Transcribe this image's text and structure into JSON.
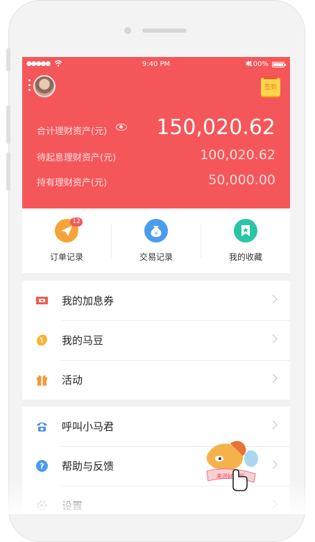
{
  "status_bar": {
    "signal": "●●●●●",
    "time": "9:40 PM",
    "bluetooth": "✱",
    "battery": "100%"
  },
  "header": {
    "signin_label": "签到",
    "total_label": "合计理财资产(元)",
    "total_value": "150,020.62",
    "pending_label": "待起息理财资产(元)",
    "pending_value": "100,020.62",
    "holding_label": "持有理财资产(元)",
    "holding_value": "50,000.00"
  },
  "quick_actions": [
    {
      "label": "订单记录",
      "badge": "12",
      "icon": "paper-plane-icon",
      "color": "#f6a43a"
    },
    {
      "label": "交易记录",
      "icon": "money-bag-icon",
      "color": "#4a9cf0"
    },
    {
      "label": "我的收藏",
      "icon": "bookmark-star-icon",
      "color": "#2bc4a7"
    }
  ],
  "menu_group_1": [
    {
      "label": "我的加息券",
      "icon": "coupon-icon",
      "color": "#f15a4b"
    },
    {
      "label": "我的马豆",
      "icon": "bean-icon",
      "color": "#f6b53a"
    },
    {
      "label": "活动",
      "icon": "gift-icon",
      "color": "#f39a3a"
    }
  ],
  "menu_group_2": [
    {
      "label": "呼叫小马君",
      "icon": "phone-icon",
      "color": "#4a90e2"
    },
    {
      "label": "帮助与反馈",
      "icon": "help-icon",
      "color": "#4a9cf0"
    },
    {
      "label": "设置",
      "icon": "settings-icon",
      "color": "#bbbbbb"
    }
  ],
  "mascot": {
    "banner_text": "来送好礼啦"
  }
}
